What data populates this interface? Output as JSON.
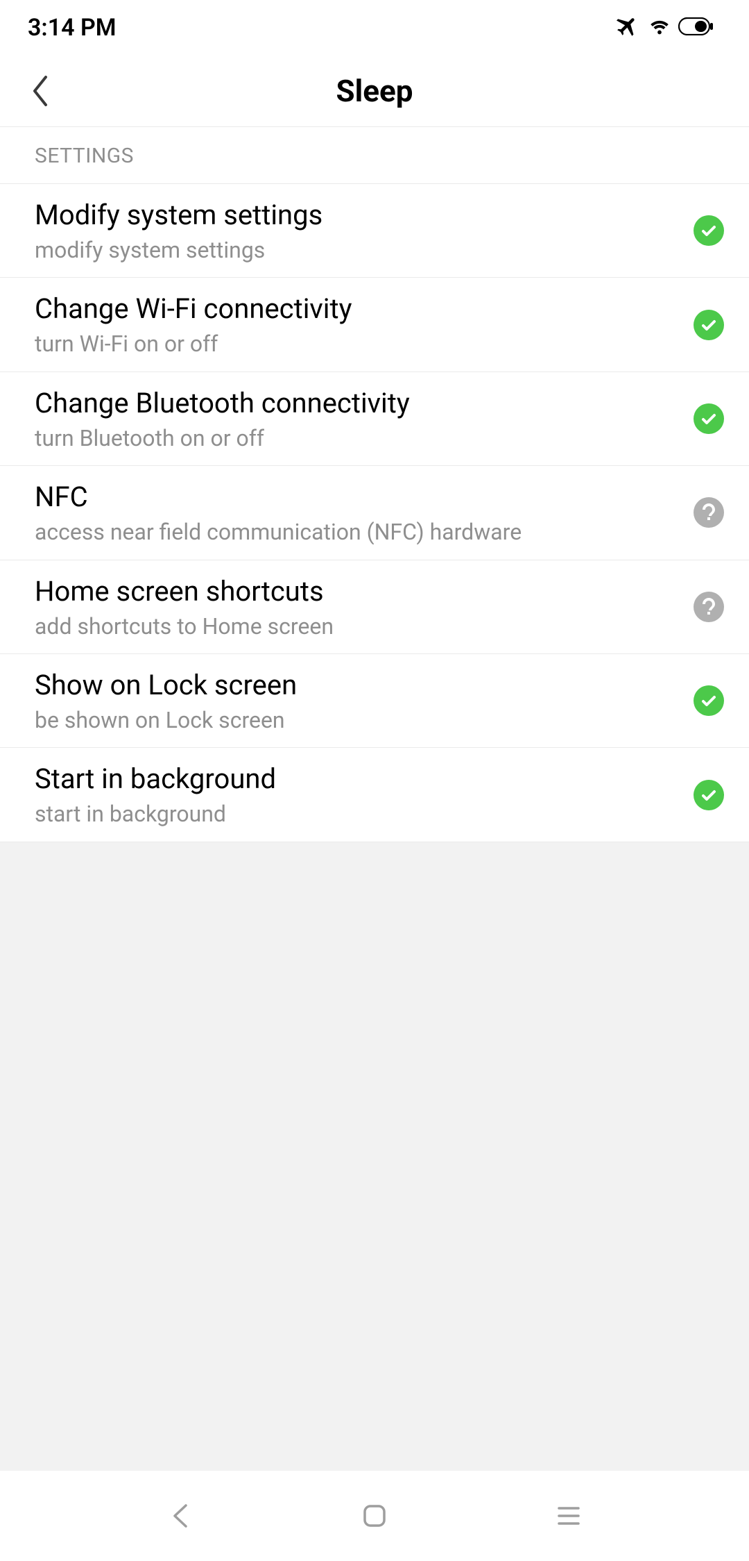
{
  "status_bar": {
    "time": "3:14 PM"
  },
  "header": {
    "title": "Sleep"
  },
  "section": {
    "label": "SETTINGS"
  },
  "permissions": [
    {
      "title": "Modify system settings",
      "subtitle": "modify system settings",
      "status": "allow"
    },
    {
      "title": "Change Wi-Fi connectivity",
      "subtitle": "turn Wi-Fi on or off",
      "status": "allow"
    },
    {
      "title": "Change Bluetooth connectivity",
      "subtitle": "turn Bluetooth on or off",
      "status": "allow"
    },
    {
      "title": "NFC",
      "subtitle": "access near field communication (NFC) hardware",
      "status": "ask"
    },
    {
      "title": "Home screen shortcuts",
      "subtitle": "add shortcuts to Home screen",
      "status": "ask"
    },
    {
      "title": "Show on Lock screen",
      "subtitle": "be shown on Lock screen",
      "status": "allow"
    },
    {
      "title": "Start in background",
      "subtitle": "start in background",
      "status": "allow"
    }
  ]
}
